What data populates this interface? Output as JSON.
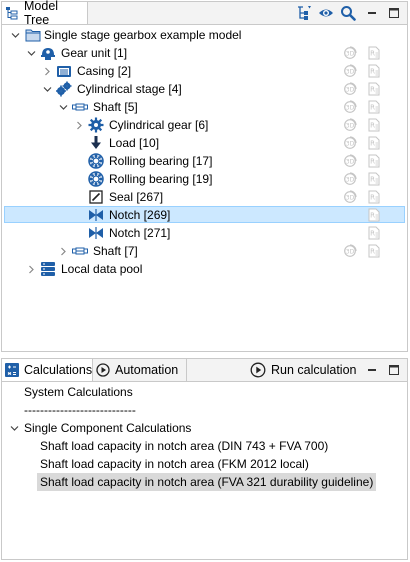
{
  "model_tree": {
    "tab_label": "Model Tree",
    "items": [
      {
        "label": "Single stage gearbox example model",
        "icon": "folder-icon",
        "expander": "expanded"
      },
      {
        "label": "Gear unit [1]",
        "icon": "gear-unit-icon",
        "expander": "expanded"
      },
      {
        "label": "Casing [2]",
        "icon": "casing-icon",
        "expander": "collapsed"
      },
      {
        "label": "Cylindrical stage [4]",
        "icon": "cylindrical-stage-icon",
        "expander": "expanded"
      },
      {
        "label": "Shaft [5]",
        "icon": "shaft-icon",
        "expander": "expanded"
      },
      {
        "label": "Cylindrical gear [6]",
        "icon": "cylindrical-gear-icon",
        "expander": "collapsed"
      },
      {
        "label": "Load [10]",
        "icon": "load-arrow-icon",
        "expander": "none"
      },
      {
        "label": "Rolling bearing [17]",
        "icon": "rolling-bearing-icon",
        "expander": "none"
      },
      {
        "label": "Rolling bearing [19]",
        "icon": "rolling-bearing-icon",
        "expander": "none"
      },
      {
        "label": "Seal [267]",
        "icon": "seal-icon",
        "expander": "none"
      },
      {
        "label": "Notch [269]",
        "icon": "notch-icon",
        "expander": "none",
        "selected": true
      },
      {
        "label": "Notch [271]",
        "icon": "notch-icon",
        "expander": "none"
      },
      {
        "label": "Shaft [7]",
        "icon": "shaft-icon",
        "expander": "collapsed"
      },
      {
        "label": "Local data pool",
        "icon": "data-pool-icon",
        "expander": "collapsed"
      }
    ]
  },
  "calculations": {
    "tab_label": "Calculations",
    "automation_tab_label": "Automation",
    "run_button_label": "Run calculation",
    "items": [
      {
        "label": "System Calculations",
        "kind": "header"
      },
      {
        "label": "----------------------------",
        "kind": "separator"
      },
      {
        "label": "Single Component Calculations",
        "kind": "header"
      },
      {
        "label": "Shaft load capacity in notch area (DIN 743 + FVA 700)",
        "kind": "item"
      },
      {
        "label": "Shaft load capacity in notch area (FKM 2012 local)",
        "kind": "item"
      },
      {
        "label": "Shaft load capacity in notch area (FVA 321 durability guideline)",
        "kind": "item",
        "selected": true
      }
    ]
  },
  "colors": {
    "accent_blue": "#1f5fa8",
    "selection_bg": "#cce8ff",
    "selection_border": "#99d1ff",
    "calc_selection_bg": "#d9d9d9"
  }
}
